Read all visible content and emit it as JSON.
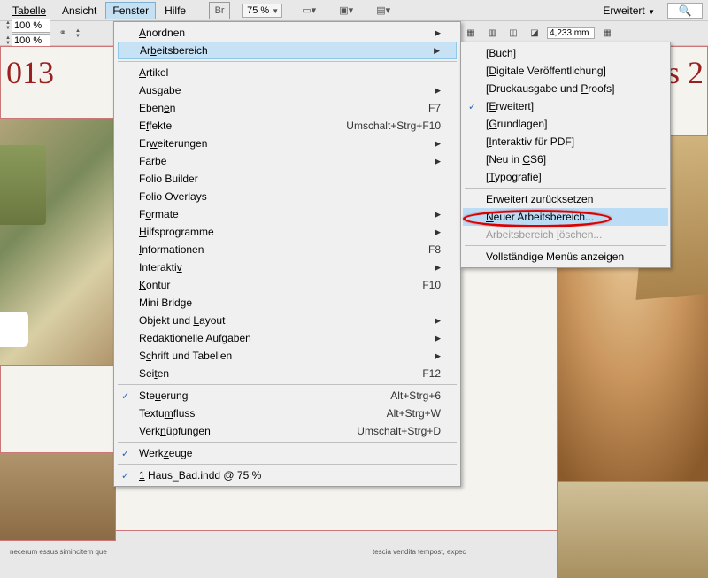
{
  "topmenu": {
    "tabelle": "Tabelle",
    "ansicht": "Ansicht",
    "fenster": "Fenster",
    "hilfe": "Hilfe",
    "br": "Br",
    "zoom": "75 %",
    "erweitert": "Erweitert"
  },
  "secondbar": {
    "pct1": "100 %",
    "pct2": "100 %"
  },
  "control": {
    "measure": "4,233 mm"
  },
  "canvas": {
    "year_left": "013",
    "year_right": "s 2",
    "lorem1": "necerum essus simincitem que",
    "lorem2": "tescia vendita tempost, expec"
  },
  "fenster_menu": {
    "anordnen": "Anordnen",
    "arbeitsbereich": "Arbeitsbereich",
    "artikel": "Artikel",
    "ausgabe": "Ausgabe",
    "ebenen": "Ebenen",
    "ebenen_sc": "F7",
    "effekte": "Effekte",
    "effekte_sc": "Umschalt+Strg+F10",
    "erweiterungen": "Erweiterungen",
    "farbe": "Farbe",
    "folio_builder": "Folio Builder",
    "folio_overlays": "Folio Overlays",
    "formate": "Formate",
    "hilfsprogramme": "Hilfsprogramme",
    "informationen": "Informationen",
    "informationen_sc": "F8",
    "interaktiv": "Interaktiv",
    "kontur": "Kontur",
    "kontur_sc": "F10",
    "mini_bridge": "Mini Bridge",
    "objekt_layout": "Objekt und Layout",
    "redaktionelle": "Redaktionelle Aufgaben",
    "schrift_tabellen": "Schrift und Tabellen",
    "seiten": "Seiten",
    "seiten_sc": "F12",
    "steuerung": "Steuerung",
    "steuerung_sc": "Alt+Strg+6",
    "textumfluss": "Textumfluss",
    "textumfluss_sc": "Alt+Strg+W",
    "verknuepfungen": "Verknüpfungen",
    "verknuepfungen_sc": "Umschalt+Strg+D",
    "werkzeuge": "Werkzeuge",
    "doc1": "1 Haus_Bad.indd @ 75 %"
  },
  "arbeitsbereich_menu": {
    "buch": "[Buch]",
    "digitale": "[Digitale Veröffentlichung]",
    "druck": "[Druckausgabe und Proofs]",
    "erweitert": "[Erweitert]",
    "grundlagen": "[Grundlagen]",
    "interaktiv_pdf": "[Interaktiv für PDF]",
    "neu_cs6": "[Neu in CS6]",
    "typografie": "[Typografie]",
    "reset": "Erweitert zurücksetzen",
    "neuer": "Neuer Arbeitsbereich...",
    "loeschen": "Arbeitsbereich löschen...",
    "vollstaendig": "Vollständige Menüs anzeigen"
  }
}
